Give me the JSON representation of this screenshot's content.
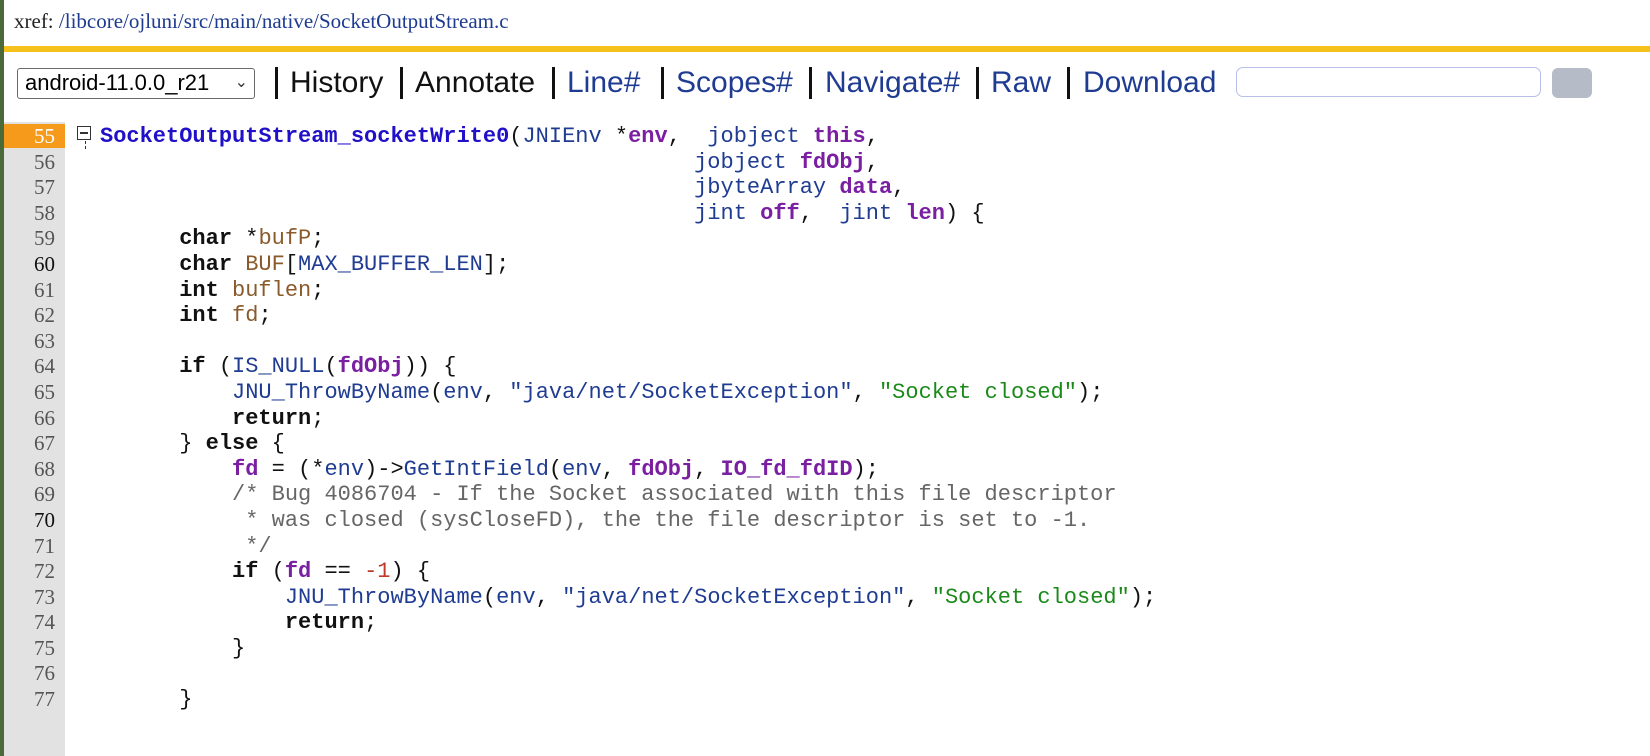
{
  "header": {
    "xref_label": "xref: ",
    "xref_path": "/libcore/ojluni/src/main/native/SocketOutputStream.c"
  },
  "toolbar": {
    "version_select": "android-11.0.0_r21",
    "history": "History",
    "annotate": "Annotate",
    "line": "Line#",
    "scopes": "Scopes#",
    "navigate": "Navigate#",
    "raw": "Raw",
    "download": "Download",
    "search_value": ""
  },
  "icons": {
    "fold": "collapse-box-icon",
    "chevron": "chevron-down-icon"
  },
  "colors": {
    "accent_bar": "#f5c21b",
    "current_line": "#f59a1a",
    "link_blue": "#1f3c92",
    "function_blue": "#2010c8",
    "keyword": "#111111",
    "param": "#7a1fa2",
    "local_var": "#8a5a2a",
    "string": "#1a8a1a",
    "comment": "#666666"
  },
  "code": {
    "lines": [
      {
        "num": "55",
        "tokens": [
          [
            "SocketOutputStream_socketWrite0",
            "fn"
          ],
          [
            "(",
            "d"
          ],
          [
            "JNIEnv",
            "t"
          ],
          [
            " *",
            "d"
          ],
          [
            "env",
            "p"
          ],
          [
            ",  ",
            "d"
          ],
          [
            "jobject",
            "t"
          ],
          [
            " ",
            "d"
          ],
          [
            "this",
            "p"
          ],
          [
            ",",
            "d"
          ]
        ]
      },
      {
        "num": "56",
        "tokens": [
          [
            "                                             ",
            "d"
          ],
          [
            "jobject",
            "t"
          ],
          [
            " ",
            "d"
          ],
          [
            "fdObj",
            "p"
          ],
          [
            ",",
            "d"
          ]
        ]
      },
      {
        "num": "57",
        "tokens": [
          [
            "                                             ",
            "d"
          ],
          [
            "jbyteArray",
            "t"
          ],
          [
            " ",
            "d"
          ],
          [
            "data",
            "p"
          ],
          [
            ",",
            "d"
          ]
        ]
      },
      {
        "num": "58",
        "tokens": [
          [
            "                                             ",
            "d"
          ],
          [
            "jint",
            "t"
          ],
          [
            " ",
            "d"
          ],
          [
            "off",
            "p"
          ],
          [
            ",  ",
            "d"
          ],
          [
            "jint",
            "t"
          ],
          [
            " ",
            "d"
          ],
          [
            "len",
            "p"
          ],
          [
            ") {",
            "d"
          ]
        ]
      },
      {
        "num": "59",
        "tokens": [
          [
            "      ",
            "d"
          ],
          [
            "char",
            "k"
          ],
          [
            " *",
            "d"
          ],
          [
            "bufP",
            "v"
          ],
          [
            ";",
            "d"
          ]
        ]
      },
      {
        "num": "60",
        "tokens": [
          [
            "      ",
            "d"
          ],
          [
            "char",
            "k"
          ],
          [
            " ",
            "d"
          ],
          [
            "BUF",
            "v"
          ],
          [
            "[",
            "d"
          ],
          [
            "MAX_BUFFER_LEN",
            "t"
          ],
          [
            "];",
            "d"
          ]
        ]
      },
      {
        "num": "61",
        "tokens": [
          [
            "      ",
            "d"
          ],
          [
            "int",
            "k"
          ],
          [
            " ",
            "d"
          ],
          [
            "buflen",
            "v"
          ],
          [
            ";",
            "d"
          ]
        ]
      },
      {
        "num": "62",
        "tokens": [
          [
            "      ",
            "d"
          ],
          [
            "int",
            "k"
          ],
          [
            " ",
            "d"
          ],
          [
            "fd",
            "v"
          ],
          [
            ";",
            "d"
          ]
        ]
      },
      {
        "num": "63",
        "tokens": []
      },
      {
        "num": "64",
        "tokens": [
          [
            "      ",
            "d"
          ],
          [
            "if",
            "k"
          ],
          [
            " (",
            "d"
          ],
          [
            "IS_NULL",
            "t"
          ],
          [
            "(",
            "d"
          ],
          [
            "fdObj",
            "p"
          ],
          [
            ")) {",
            "d"
          ]
        ]
      },
      {
        "num": "65",
        "tokens": [
          [
            "          ",
            "d"
          ],
          [
            "JNU_ThrowByName",
            "t"
          ],
          [
            "(",
            "d"
          ],
          [
            "env",
            "t"
          ],
          [
            ", ",
            "d"
          ],
          [
            "\"java/net/SocketException\"",
            "t"
          ],
          [
            ", ",
            "d"
          ],
          [
            "\"Socket closed\"",
            "s"
          ],
          [
            ");",
            "d"
          ]
        ]
      },
      {
        "num": "66",
        "tokens": [
          [
            "          ",
            "d"
          ],
          [
            "return",
            "k"
          ],
          [
            ";",
            "d"
          ]
        ]
      },
      {
        "num": "67",
        "tokens": [
          [
            "      } ",
            "d"
          ],
          [
            "else",
            "k"
          ],
          [
            " {",
            "d"
          ]
        ]
      },
      {
        "num": "68",
        "tokens": [
          [
            "          ",
            "d"
          ],
          [
            "fd",
            "p"
          ],
          [
            " = (*",
            "d"
          ],
          [
            "env",
            "t"
          ],
          [
            ")->",
            "d"
          ],
          [
            "GetIntField",
            "t"
          ],
          [
            "(",
            "d"
          ],
          [
            "env",
            "t"
          ],
          [
            ", ",
            "d"
          ],
          [
            "fdObj",
            "p"
          ],
          [
            ", ",
            "d"
          ],
          [
            "IO_fd_fdID",
            "p"
          ],
          [
            ");",
            "d"
          ]
        ]
      },
      {
        "num": "69",
        "tokens": [
          [
            "          ",
            "d"
          ],
          [
            "/* Bug 4086704 - If the Socket associated with this file descriptor",
            "c"
          ]
        ]
      },
      {
        "num": "70",
        "tokens": [
          [
            "           ",
            "d"
          ],
          [
            "* was closed (sysCloseFD), the the file descriptor is set to -1.",
            "c"
          ]
        ]
      },
      {
        "num": "71",
        "tokens": [
          [
            "           ",
            "d"
          ],
          [
            "*/",
            "c"
          ]
        ]
      },
      {
        "num": "72",
        "tokens": [
          [
            "          ",
            "d"
          ],
          [
            "if",
            "k"
          ],
          [
            " (",
            "d"
          ],
          [
            "fd",
            "p"
          ],
          [
            " == ",
            "d"
          ],
          [
            "-1",
            "n"
          ],
          [
            ") {",
            "d"
          ]
        ]
      },
      {
        "num": "73",
        "tokens": [
          [
            "              ",
            "d"
          ],
          [
            "JNU_ThrowByName",
            "t"
          ],
          [
            "(",
            "d"
          ],
          [
            "env",
            "t"
          ],
          [
            ", ",
            "d"
          ],
          [
            "\"java/net/SocketException\"",
            "t"
          ],
          [
            ", ",
            "d"
          ],
          [
            "\"Socket closed\"",
            "s"
          ],
          [
            ");",
            "d"
          ]
        ]
      },
      {
        "num": "74",
        "tokens": [
          [
            "              ",
            "d"
          ],
          [
            "return",
            "k"
          ],
          [
            ";",
            "d"
          ]
        ]
      },
      {
        "num": "75",
        "tokens": [
          [
            "          }",
            "d"
          ]
        ]
      },
      {
        "num": "76",
        "tokens": []
      },
      {
        "num": "77",
        "tokens": [
          [
            "      }",
            "d"
          ]
        ]
      }
    ]
  }
}
